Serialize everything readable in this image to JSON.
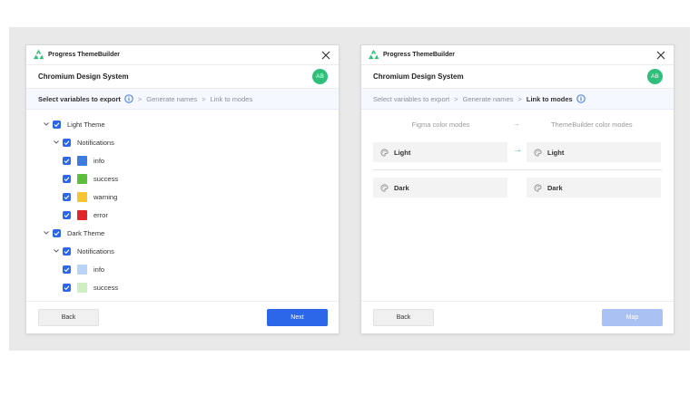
{
  "app_title": "Progress ThemeBuilder",
  "project_name": "Chromium Design System",
  "avatar_initials": "AB",
  "colors": {
    "primary": "#2b67e8",
    "avatar": "#2ebf7a",
    "green_arrow": "#2ebf7a"
  },
  "left": {
    "breadcrumb": [
      "Select variables to export",
      "Generate names",
      "Link to modes"
    ],
    "tree": [
      {
        "label": "Light Theme",
        "level": 0,
        "expandable": true
      },
      {
        "label": "Notifications",
        "level": 1,
        "expandable": true
      },
      {
        "label": "info",
        "level": 2,
        "swatch": "#3c7ddf"
      },
      {
        "label": "success",
        "level": 2,
        "swatch": "#5cbf3b"
      },
      {
        "label": "warning",
        "level": 2,
        "swatch": "#f7c531"
      },
      {
        "label": "error",
        "level": 2,
        "swatch": "#e0262b"
      },
      {
        "label": "Dark Theme",
        "level": 0,
        "expandable": true
      },
      {
        "label": "Notifications",
        "level": 1,
        "expandable": true
      },
      {
        "label": "info",
        "level": 2,
        "swatch": "#b8d3fa"
      },
      {
        "label": "success",
        "level": 2,
        "swatch": "#cdeec1"
      }
    ],
    "back_label": "Back",
    "next_label": "Next"
  },
  "right": {
    "breadcrumb": [
      "Select variables to export",
      "Generate names",
      "Link to modes"
    ],
    "figma_modes_header": "Figma color modes",
    "tb_modes_header": "ThemeBuilder color modes",
    "rows": [
      {
        "figma": "Light",
        "tb": "Light",
        "linked": true
      },
      {
        "figma": "Dark",
        "tb": "Dark",
        "linked": false
      }
    ],
    "back_label": "Back",
    "map_label": "Map"
  }
}
